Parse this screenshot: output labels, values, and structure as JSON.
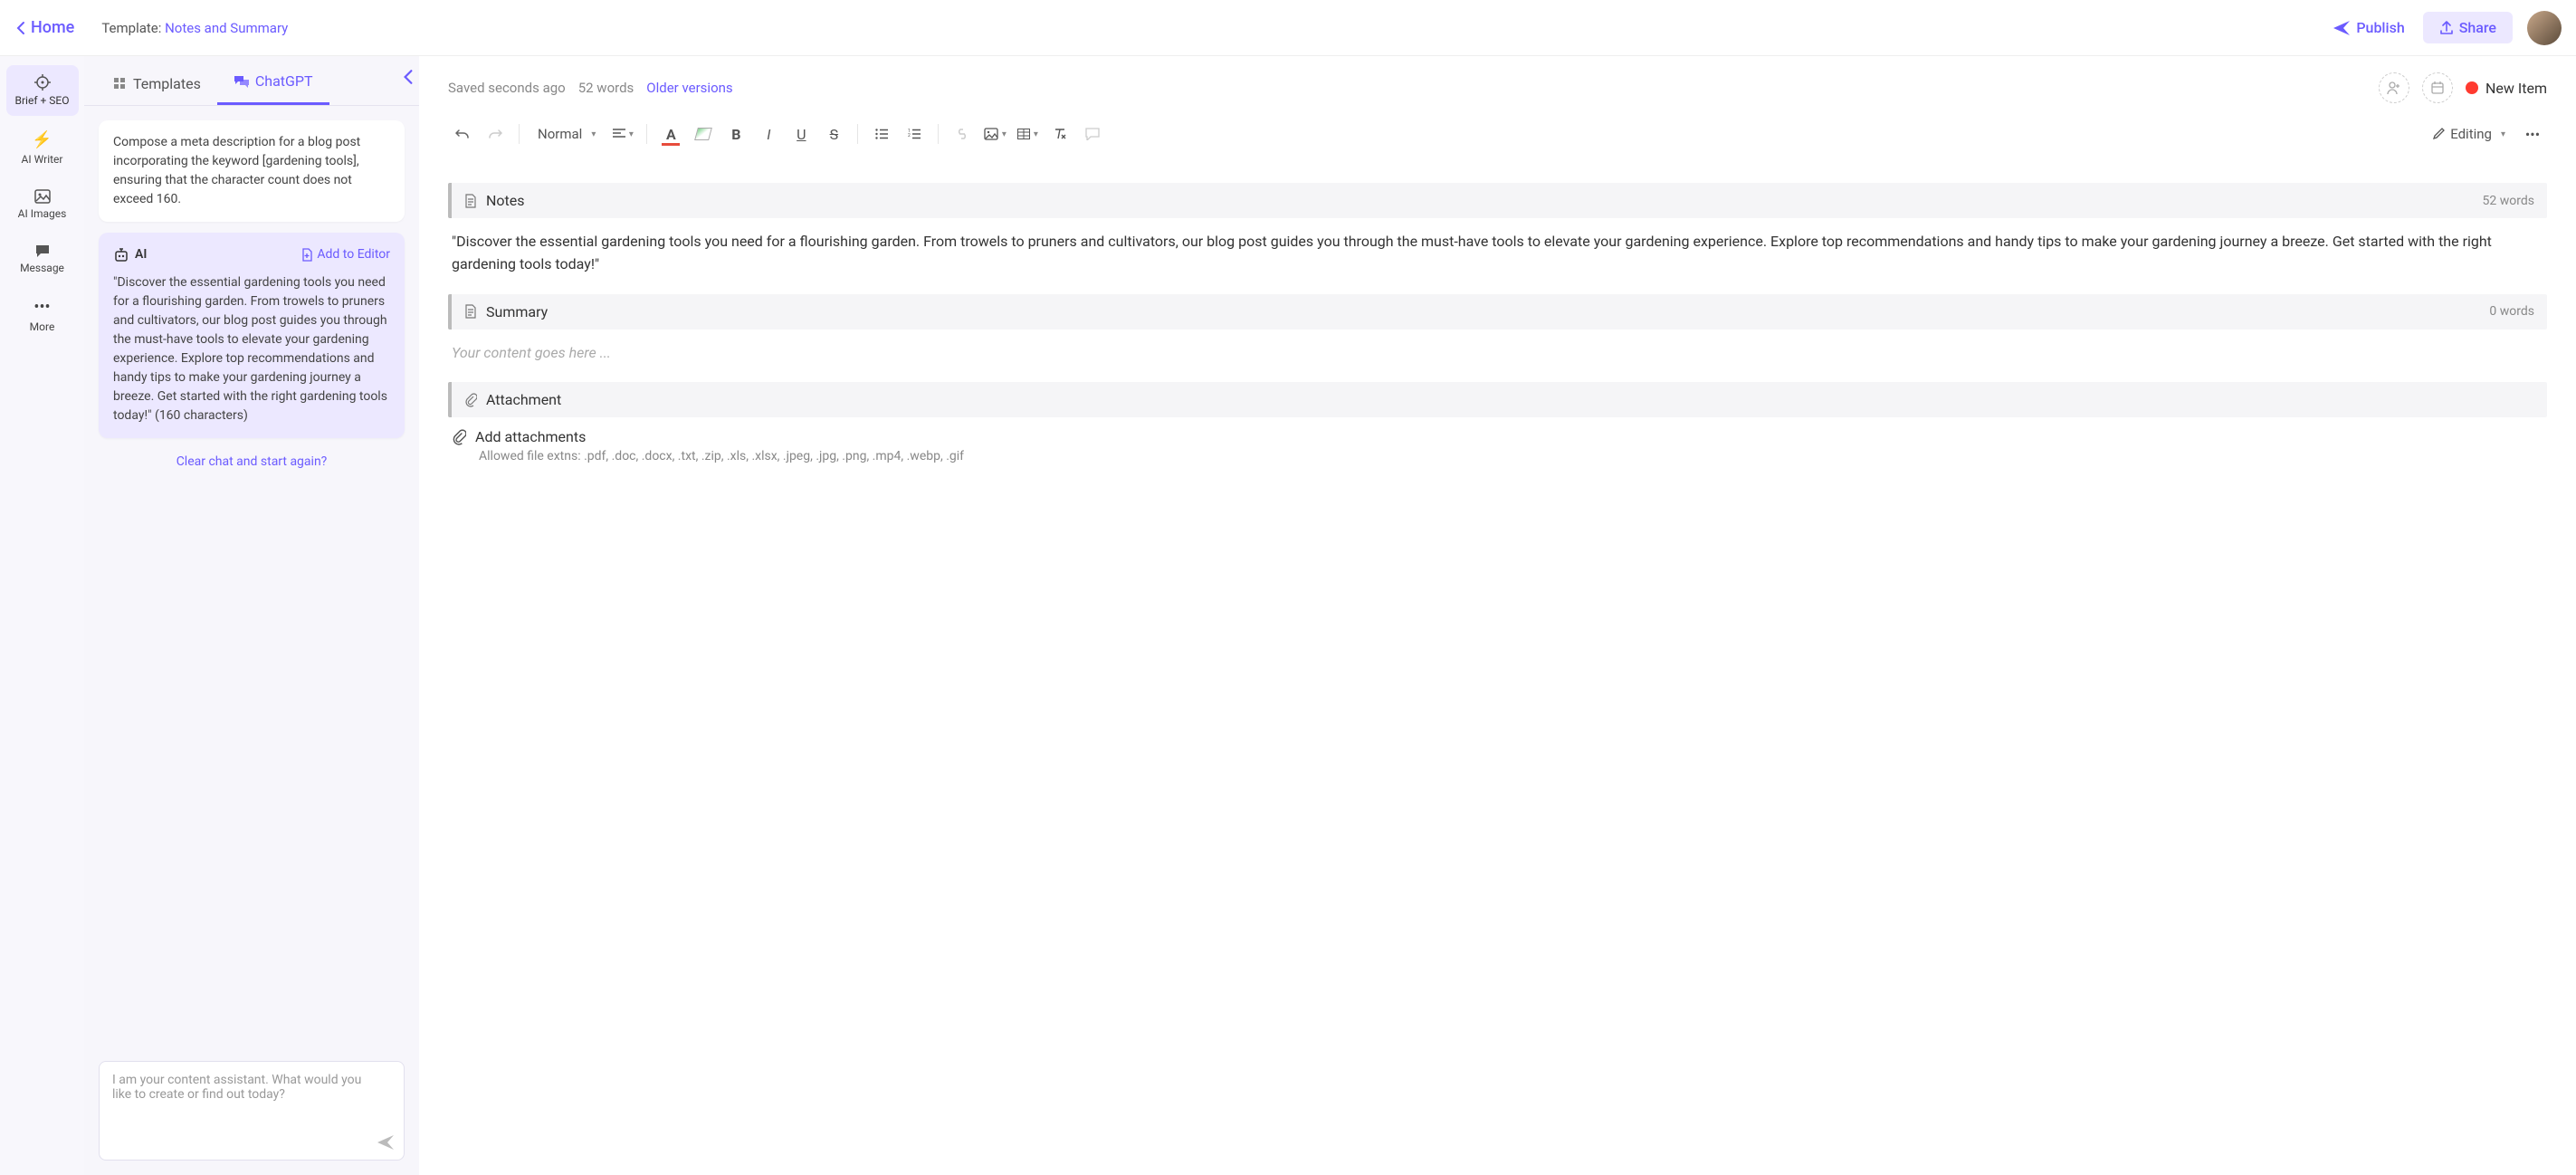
{
  "topbar": {
    "home": "Home",
    "template_label": "Template: ",
    "template_name": "Notes and Summary",
    "publish": "Publish",
    "share": "Share"
  },
  "rail": {
    "brief": "Brief + SEO",
    "ai_writer": "AI Writer",
    "ai_images": "AI Images",
    "message": "Message",
    "more": "More"
  },
  "chat": {
    "tab_templates": "Templates",
    "tab_chatgpt": "ChatGPT",
    "user_msg": "Compose a meta description for a blog post incorporating the keyword [gardening tools], ensuring that the character count does not exceed 160.",
    "ai_label": "AI",
    "add_to_editor": "Add to Editor",
    "ai_msg": "\"Discover the essential gardening tools you need for a flourishing garden. From trowels to pruners and cultivators, our blog post guides you through the must-have tools to elevate your gardening experience. Explore top recommendations and handy tips to make your gardening journey a breeze. Get started with the right gardening tools today!\" (160 characters)",
    "clear": "Clear chat and start again?",
    "input_placeholder": "I am your content assistant. What would you like to create or find out today?"
  },
  "editor": {
    "saved": "Saved seconds ago",
    "word_count": "52 words",
    "older": "Older versions",
    "new_item": "New Item",
    "style": "Normal",
    "editing": "Editing",
    "notes": {
      "title": "Notes",
      "count": "52 words",
      "body": "\"Discover the essential gardening tools you need for a flourishing garden. From trowels to pruners and cultivators, our blog post guides you through the must-have tools to elevate your gardening experience. Explore top recommendations and handy tips to make your gardening journey a breeze. Get started with the right gardening tools today!\""
    },
    "summary": {
      "title": "Summary",
      "count": "0 words",
      "placeholder": "Your content goes here ..."
    },
    "attachment": {
      "title": "Attachment",
      "add": "Add attachments",
      "allowed": "Allowed file extns: .pdf, .doc, .docx, .txt, .zip, .xls, .xlsx, .jpeg, .jpg, .png, .mp4, .webp, .gif"
    }
  }
}
